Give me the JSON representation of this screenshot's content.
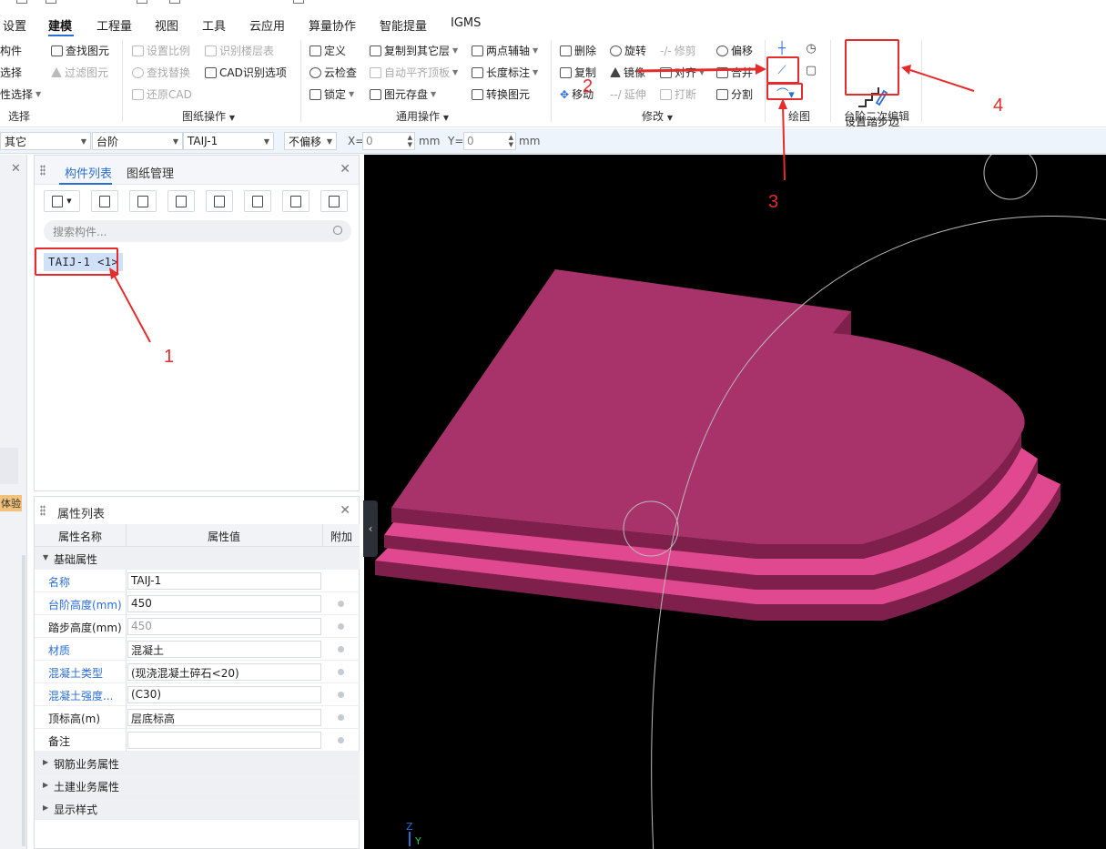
{
  "menu": {
    "items": [
      {
        "label": "设置",
        "active": false
      },
      {
        "label": "建模",
        "active": true
      },
      {
        "label": "工程量",
        "active": false
      },
      {
        "label": "视图",
        "active": false
      },
      {
        "label": "工具",
        "active": false
      },
      {
        "label": "云应用",
        "active": false
      },
      {
        "label": "算量协作",
        "active": false
      },
      {
        "label": "智能提量",
        "active": false
      },
      {
        "label": "IGMS",
        "active": false
      }
    ]
  },
  "ribbon": {
    "select_group": {
      "items": [
        "构件",
        "选择",
        "性选择"
      ],
      "label": "选择"
    },
    "find_group": {
      "find_element": "查找图元",
      "filter_element": "过滤图元"
    },
    "drawing_ops": {
      "set_scale": "设置比例",
      "identify_floors": "识别楼层表",
      "find_replace": "查找替换",
      "cad_options": "CAD识别选项",
      "restore_cad": "还原CAD",
      "label": "图纸操作"
    },
    "general_ops": {
      "define": "定义",
      "copy_to_other_layer": "复制到其它层",
      "two_point_axis": "两点辅轴",
      "cloud_check": "云检查",
      "auto_align_slab": "自动平齐顶板",
      "length_mark": "长度标注",
      "lock": "锁定",
      "element_save": "图元存盘",
      "convert_element": "转换图元",
      "label": "通用操作"
    },
    "modify": {
      "delete": "删除",
      "rotate": "旋转",
      "trim": "修剪",
      "offset": "偏移",
      "copy": "复制",
      "mirror": "镜像",
      "align": "对齐",
      "merge": "合并",
      "move": "移动",
      "extend": "延伸",
      "break": "打断",
      "split": "分割",
      "label": "修改"
    },
    "draw_label": "绘图",
    "step_edit": {
      "button": "设置踏步边",
      "label": "台阶二次编辑"
    }
  },
  "options_bar": {
    "category": "其它",
    "type": "台阶",
    "component": "TAIJ-1",
    "offset_mode": "不偏移",
    "x_label": "X=",
    "x_value": "0",
    "y_label": "Y=",
    "y_value": "0",
    "unit": "mm"
  },
  "left_stub": {
    "tag": "体验"
  },
  "component_panel": {
    "tabs": [
      "构件列表",
      "图纸管理"
    ],
    "search_placeholder": "搜索构件...",
    "items": [
      "TAIJ-1 <1>"
    ]
  },
  "properties": {
    "title": "属性列表",
    "headers": [
      "属性名称",
      "属性值",
      "附加"
    ],
    "section": "基础属性",
    "rows": [
      {
        "name": "名称",
        "value": "TAIJ-1",
        "blue": true,
        "dot": false,
        "grey": false
      },
      {
        "name": "台阶高度(mm)",
        "value": "450",
        "blue": true,
        "dot": true,
        "grey": false
      },
      {
        "name": "踏步高度(mm)",
        "value": "450",
        "blue": false,
        "dot": true,
        "grey": true
      },
      {
        "name": "材质",
        "value": "混凝土",
        "blue": true,
        "dot": true,
        "grey": false
      },
      {
        "name": "混凝土类型",
        "value": "(现浇混凝土碎石<20)",
        "blue": true,
        "dot": true,
        "grey": false
      },
      {
        "name": "混凝土强度...",
        "value": "(C30)",
        "blue": true,
        "dot": true,
        "grey": false
      },
      {
        "name": "顶标高(m)",
        "value": "层底标高",
        "blue": false,
        "dot": true,
        "grey": false
      },
      {
        "name": "备注",
        "value": "",
        "blue": false,
        "dot": true,
        "grey": false
      }
    ],
    "collapsed_sections": [
      "钢筋业务属性",
      "土建业务属性",
      "显示样式"
    ]
  },
  "viewport": {
    "step_color": "#a8326a",
    "step_highlight": "#e0498f",
    "step_dark": "#7e1f4c",
    "axis_labels": [
      "Z",
      "Y"
    ]
  },
  "annotations": [
    "1",
    "2",
    "3",
    "4"
  ]
}
